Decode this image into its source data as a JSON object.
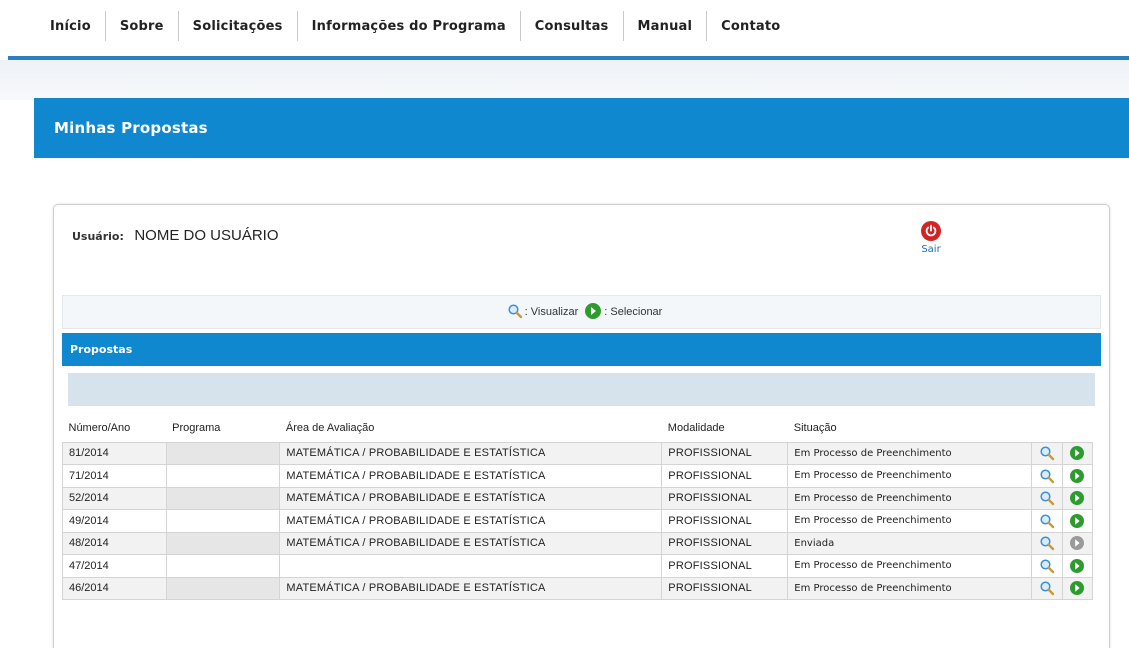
{
  "nav": {
    "items": [
      "Início",
      "Sobre",
      "Solicitações",
      "Informações do Programa",
      "Consultas",
      "Manual",
      "Contato"
    ]
  },
  "page": {
    "title": "Minhas Propostas"
  },
  "user": {
    "label": "Usuário:",
    "name": "NOME DO USUÁRIO",
    "logout_label": "Sair"
  },
  "legend": {
    "view_label": ": Visualizar",
    "select_label": ": Selecionar"
  },
  "section": {
    "title": "Propostas"
  },
  "table": {
    "headers": [
      "Número/Ano",
      "Programa",
      "Área de Avaliação",
      "Modalidade",
      "Situação"
    ],
    "rows": [
      {
        "numero": "81/2014",
        "programa": "",
        "area": "MATEMÁTICA / PROBABILIDADE E ESTATÍSTICA",
        "modalidade": "PROFISSIONAL",
        "situacao": "Em Processo de Preenchimento",
        "select_enabled": true
      },
      {
        "numero": "71/2014",
        "programa": "",
        "area": "MATEMÁTICA / PROBABILIDADE E ESTATÍSTICA",
        "modalidade": "PROFISSIONAL",
        "situacao": "Em Processo de Preenchimento",
        "select_enabled": true
      },
      {
        "numero": "52/2014",
        "programa": "",
        "area": "MATEMÁTICA / PROBABILIDADE E ESTATÍSTICA",
        "modalidade": "PROFISSIONAL",
        "situacao": "Em Processo de Preenchimento",
        "select_enabled": true
      },
      {
        "numero": "49/2014",
        "programa": "",
        "area": "MATEMÁTICA / PROBABILIDADE E ESTATÍSTICA",
        "modalidade": "PROFISSIONAL",
        "situacao": "Em Processo de Preenchimento",
        "select_enabled": true
      },
      {
        "numero": "48/2014",
        "programa": "",
        "area": "MATEMÁTICA / PROBABILIDADE E ESTATÍSTICA",
        "modalidade": "PROFISSIONAL",
        "situacao": "Enviada",
        "select_enabled": false
      },
      {
        "numero": "47/2014",
        "programa": "",
        "area": "",
        "modalidade": "PROFISSIONAL",
        "situacao": "Em Processo de Preenchimento",
        "select_enabled": true
      },
      {
        "numero": "46/2014",
        "programa": "",
        "area": "MATEMÁTICA / PROBABILIDADE E ESTATÍSTICA",
        "modalidade": "PROFISSIONAL",
        "situacao": "Em Processo de Preenchimento",
        "select_enabled": true
      }
    ]
  },
  "colors": {
    "brand_blue": "#0f88d0",
    "logout_red": "#d32323",
    "select_green": "#2e9b2e",
    "disabled_gray": "#9a9a9a"
  },
  "icons": {
    "view": "magnifier-icon",
    "select": "select-arrow-icon",
    "logout": "power-icon"
  }
}
